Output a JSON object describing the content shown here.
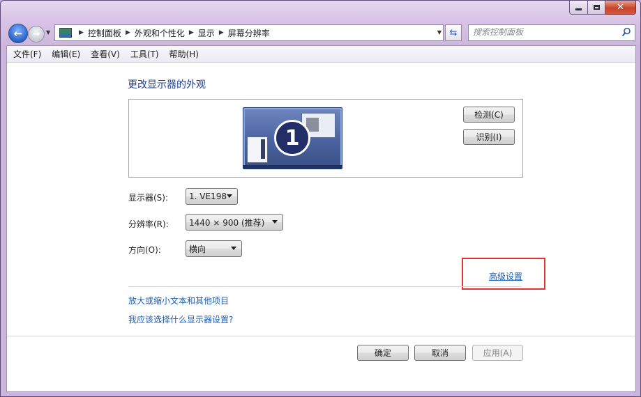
{
  "window": {
    "close_glyph": "✕"
  },
  "nav": {
    "back_icon": "arrow-left-icon",
    "forward_icon": "arrow-right-icon",
    "breadcrumbs": [
      "控制面板",
      "外观和个性化",
      "显示",
      "屏幕分辨率"
    ],
    "search_placeholder": "搜索控制面板"
  },
  "menu": [
    "文件(F)",
    "编辑(E)",
    "查看(V)",
    "工具(T)",
    "帮助(H)"
  ],
  "main": {
    "heading": "更改显示器的外观",
    "monitor_number": "1",
    "detect_button": "检测(C)",
    "identify_button": "识别(I)",
    "display_label": "显示器(S):",
    "display_value": "1. VE198",
    "resolution_label": "分辨率(R):",
    "resolution_value": "1440 × 900 (推荐)",
    "orientation_label": "方向(O):",
    "orientation_value": "横向",
    "advanced_link": "高级设置",
    "text_size_link": "放大或缩小文本和其他项目",
    "help_link": "我应该选择什么显示器设置?"
  },
  "footer": {
    "ok_button": "确定",
    "cancel_button": "取消",
    "apply_button": "应用(A)"
  },
  "colors": {
    "link": "#1a5fb4",
    "heading": "#1e3e8c",
    "highlight_border": "#e3342f"
  }
}
